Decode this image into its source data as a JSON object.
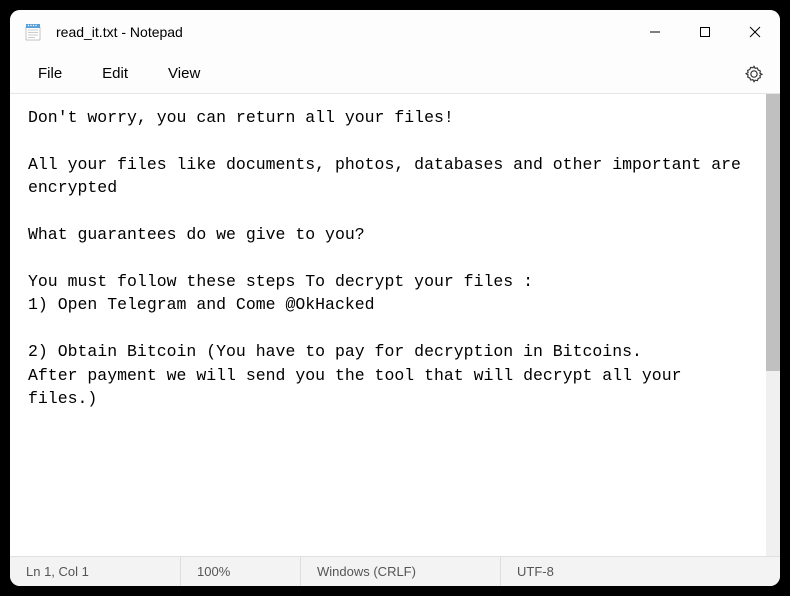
{
  "window": {
    "title": "read_it.txt - Notepad"
  },
  "menu": {
    "file": "File",
    "edit": "Edit",
    "view": "View"
  },
  "document": {
    "text": "Don't worry, you can return all your files!\n\nAll your files like documents, photos, databases and other important are encrypted\n\nWhat guarantees do we give to you?\n\nYou must follow these steps To decrypt your files :\n1) Open Telegram and Come @OkHacked\n\n2) Obtain Bitcoin (You have to pay for decryption in Bitcoins.\nAfter payment we will send you the tool that will decrypt all your files.)"
  },
  "status": {
    "position": "Ln 1, Col 1",
    "zoom": "100%",
    "line_ending": "Windows (CRLF)",
    "encoding": "UTF-8"
  }
}
